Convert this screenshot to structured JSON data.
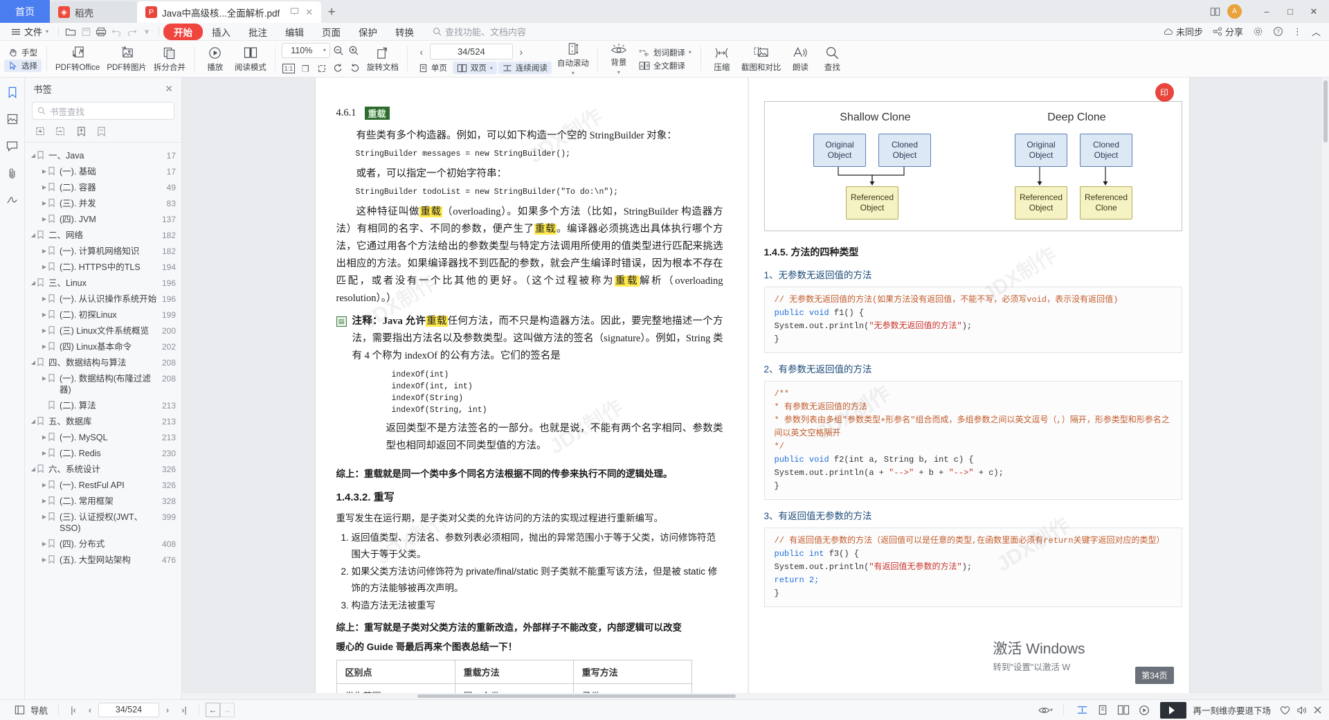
{
  "tabs": {
    "home": "首页",
    "cloud": "稻壳",
    "document": "Java中高级核...全面解析.pdf",
    "new_tab": "+"
  },
  "window": {
    "minimize": "–",
    "maximize": "□",
    "close": "✕"
  },
  "menubar": {
    "file": "文件",
    "tabs": [
      "开始",
      "插入",
      "批注",
      "编辑",
      "页面",
      "保护",
      "转换"
    ],
    "active_tab": "开始",
    "search_placeholder": "查找功能、文档内容",
    "right_items": [
      "未同步",
      "分享"
    ]
  },
  "ribbon": {
    "hand": "手型",
    "select": "选择",
    "pdf_to_office": "PDF转Office",
    "pdf_to_image": "PDF转图片",
    "split_merge": "拆分合并",
    "play": "播放",
    "read_mode": "阅读模式",
    "zoom_value": "110%",
    "actual_size": "1:1",
    "rotate_doc": "旋转文档",
    "page_value": "34/524",
    "single_page": "单页",
    "double_page": "双页",
    "continuous": "连续阅读",
    "auto_scroll": "自动滚动",
    "background": "背景",
    "word_translate": "划词翻译",
    "full_translate": "全文翻译",
    "compress": "压缩",
    "screenshot_compare": "截图和对比",
    "read_aloud": "朗读",
    "find": "查找"
  },
  "panel": {
    "title": "书签",
    "search_placeholder": "书签查找",
    "close": "✕",
    "bookmarks": [
      {
        "level": 1,
        "label": "一、Java",
        "page": "17",
        "expanded": true
      },
      {
        "level": 2,
        "label": "(一). 基础",
        "page": "17",
        "expanded": false
      },
      {
        "level": 2,
        "label": "(二). 容器",
        "page": "49",
        "expanded": false
      },
      {
        "level": 2,
        "label": "(三). 并发",
        "page": "83",
        "expanded": false
      },
      {
        "level": 2,
        "label": "(四). JVM",
        "page": "137",
        "expanded": false
      },
      {
        "level": 1,
        "label": "二、网络",
        "page": "182",
        "expanded": true
      },
      {
        "level": 2,
        "label": "(一). 计算机网络知识",
        "page": "182",
        "expanded": false
      },
      {
        "level": 2,
        "label": "(二). HTTPS中的TLS",
        "page": "194",
        "expanded": false
      },
      {
        "level": 1,
        "label": "三、Linux",
        "page": "196",
        "expanded": true
      },
      {
        "level": 2,
        "label": "(一). 从认识操作系统开始",
        "page": "196",
        "expanded": false
      },
      {
        "level": 2,
        "label": "(二). 初探Linux",
        "page": "199",
        "expanded": false
      },
      {
        "level": 2,
        "label": "(三) Linux文件系统概览",
        "page": "200",
        "expanded": false
      },
      {
        "level": 2,
        "label": "(四) Linux基本命令",
        "page": "202",
        "expanded": false
      },
      {
        "level": 1,
        "label": "四、数据结构与算法",
        "page": "208",
        "expanded": true
      },
      {
        "level": 2,
        "label": "(一). 数据结构(布隆过滤器)",
        "page": "208",
        "expanded": false
      },
      {
        "level": 2,
        "label": "(二). 算法",
        "page": "213",
        "expanded": false,
        "leaf": true
      },
      {
        "level": 1,
        "label": "五、数据库",
        "page": "213",
        "expanded": true
      },
      {
        "level": 2,
        "label": "(一). MySQL",
        "page": "213",
        "expanded": false
      },
      {
        "level": 2,
        "label": "(二). Redis",
        "page": "230",
        "expanded": false
      },
      {
        "level": 1,
        "label": "六、系统设计",
        "page": "326",
        "expanded": true
      },
      {
        "level": 2,
        "label": "(一). RestFul API",
        "page": "326",
        "expanded": false
      },
      {
        "level": 2,
        "label": "(二). 常用框架",
        "page": "328",
        "expanded": false
      },
      {
        "level": 2,
        "label": "(三). 认证授权(JWT、SSO)",
        "page": "399",
        "expanded": false
      },
      {
        "level": 2,
        "label": "(四). 分布式",
        "page": "408",
        "expanded": false
      },
      {
        "level": 2,
        "label": "(五). 大型网站架构",
        "page": "476",
        "expanded": false
      }
    ]
  },
  "page_left": {
    "section_number": "4.6.1",
    "section_title": "重载",
    "para1": "有些类有多个构造器。例如，可以如下构造一个空的 StringBuilder 对象：",
    "code1": "StringBuilder messages = new StringBuilder();",
    "para2": "或者，可以指定一个初始字符串：",
    "code2": "StringBuilder todoList = new StringBuilder(\"To do:\\n\");",
    "para3_a": "这种特征叫做",
    "para3_hl1": "重载",
    "para3_b": "（overloading）。如果多个方法（比如，StringBuilder 构造器方法）有相同的名字、不同的参数，便产生了",
    "para3_hl2": "重载",
    "para3_c": "。编译器必须挑选出具体执行哪个方法，它通过用各个方法给出的参数类型与特定方法调用所使用的值类型进行匹配来挑选出相应的方法。如果编译器找不到匹配的参数，就会产生编译时错误，因为根本不存在匹配，或者没有一个比其他的更好。（这个过程被称为",
    "para3_hl3": "重载",
    "para3_d": "解析（overloading resolution）。）",
    "note_a": "注释：Java 允许",
    "note_hl": "重载",
    "note_b": "任何方法，而不只是构造器方法。因此，要完整地描述一个方法，需要指出方法名以及参数类型。这叫做方法的签名（signature）。例如，String 类有 4 个称为 indexOf 的公有方法。它们的签名是",
    "signatures": [
      "indexOf(int)",
      "indexOf(int, int)",
      "indexOf(String)",
      "indexOf(String, int)"
    ],
    "note_c": "返回类型不是方法签名的一部分。也就是说，不能有两个名字相同、参数类型也相同却返回不同类型值的方法。",
    "summary1": "综上：重载就是同一个类中多个同名方法根据不同的传参来执行不同的逻辑处理。",
    "h_override": "1.4.3.2. 重写",
    "override_def": "重写发生在运行期，是子类对父类的允许访问的方法的实现过程进行重新编写。",
    "override_items": [
      "返回值类型、方法名、参数列表必须相同，抛出的异常范围小于等于父类，访问修饰符范围大于等于父类。",
      "如果父类方法访问修饰符为 private/final/static 则子类就不能重写该方法，但是被 static 修饰的方法能够被再次声明。",
      "构造方法无法被重写"
    ],
    "summary2": "综上：重写就是子类对父类方法的重新改造，外部样子不能改变，内部逻辑可以改变",
    "guide_line": "暖心的 Guide 哥最后再来个图表总结一下！",
    "table_headers": [
      "区别点",
      "重载方法",
      "重写方法"
    ],
    "table_row1": [
      "发生范围",
      "同一个类",
      "子类"
    ]
  },
  "page_right": {
    "diagram": {
      "title_left": "Shallow Clone",
      "title_right": "Deep Clone",
      "original": "Original\nObject",
      "cloned": "Cloned\nObject",
      "referenced": "Referenced\nObject",
      "referenced_clone": "Referenced\nClone"
    },
    "heading": "1.4.5. 方法的四种类型",
    "sub1": "1、无参数无返回值的方法",
    "code1_comment": "// 无参数无返回值的方法(如果方法没有返回值，不能不写，必须写void，表示没有返回值)",
    "code1_line1_kw": "public void",
    "code1_line1": " f1() {",
    "code1_line2_pre": "    System.out.println(",
    "code1_line2_str": "\"无参数无返回值的方法\"",
    "code1_line2_post": ");",
    "code1_line3": "}",
    "sub2": "2、有参数无返回值的方法",
    "code2_l1": "/**",
    "code2_l2": "* 有参数无返回值的方法",
    "code2_l3": "* 参数列表由多组\"参数类型+形参名\"组合而成，多组参数之间以英文逗号（,）隔开，形参类型和形参名之间以英文空格隔开",
    "code2_l4": "*/",
    "code2_l5_kw": "public void",
    "code2_l5": " f2(int a, String b, int c) {",
    "code2_l6_pre": "    System.out.println(a + ",
    "code2_l6_s1": "\"-->\"",
    "code2_l6_mid": " + b + ",
    "code2_l6_s2": "\"-->\"",
    "code2_l6_post": " + c);",
    "code2_l7": "}",
    "sub3": "3、有返回值无参数的方法",
    "code3_comment": "// 有返回值无参数的方法（返回值可以是任意的类型,在函数里面必须有return关键字返回对应的类型）",
    "code3_l1_kw": "public int",
    "code3_l1": " f3() {",
    "code3_l2_pre": "    System.out.println(",
    "code3_l2_str": "\"有返回值无参数的方法\"",
    "code3_l2_post": ");",
    "code3_l3_kw": "    return",
    "code3_l3": " 2;",
    "code3_l4": "}"
  },
  "overlays": {
    "page_badge": "第34页",
    "activate_title": "激活 Windows",
    "activate_sub": "转到\"设置\"以激活 W"
  },
  "status": {
    "nav": "导航",
    "page_value": "34/524",
    "promo_text": "再一刻维亦要退下场"
  },
  "colors": {
    "accent_red": "#f0453e",
    "accent_blue": "#4a7ef0",
    "highlight_green": "#2f6b2f",
    "highlight_yellow": "#ffe94d"
  }
}
